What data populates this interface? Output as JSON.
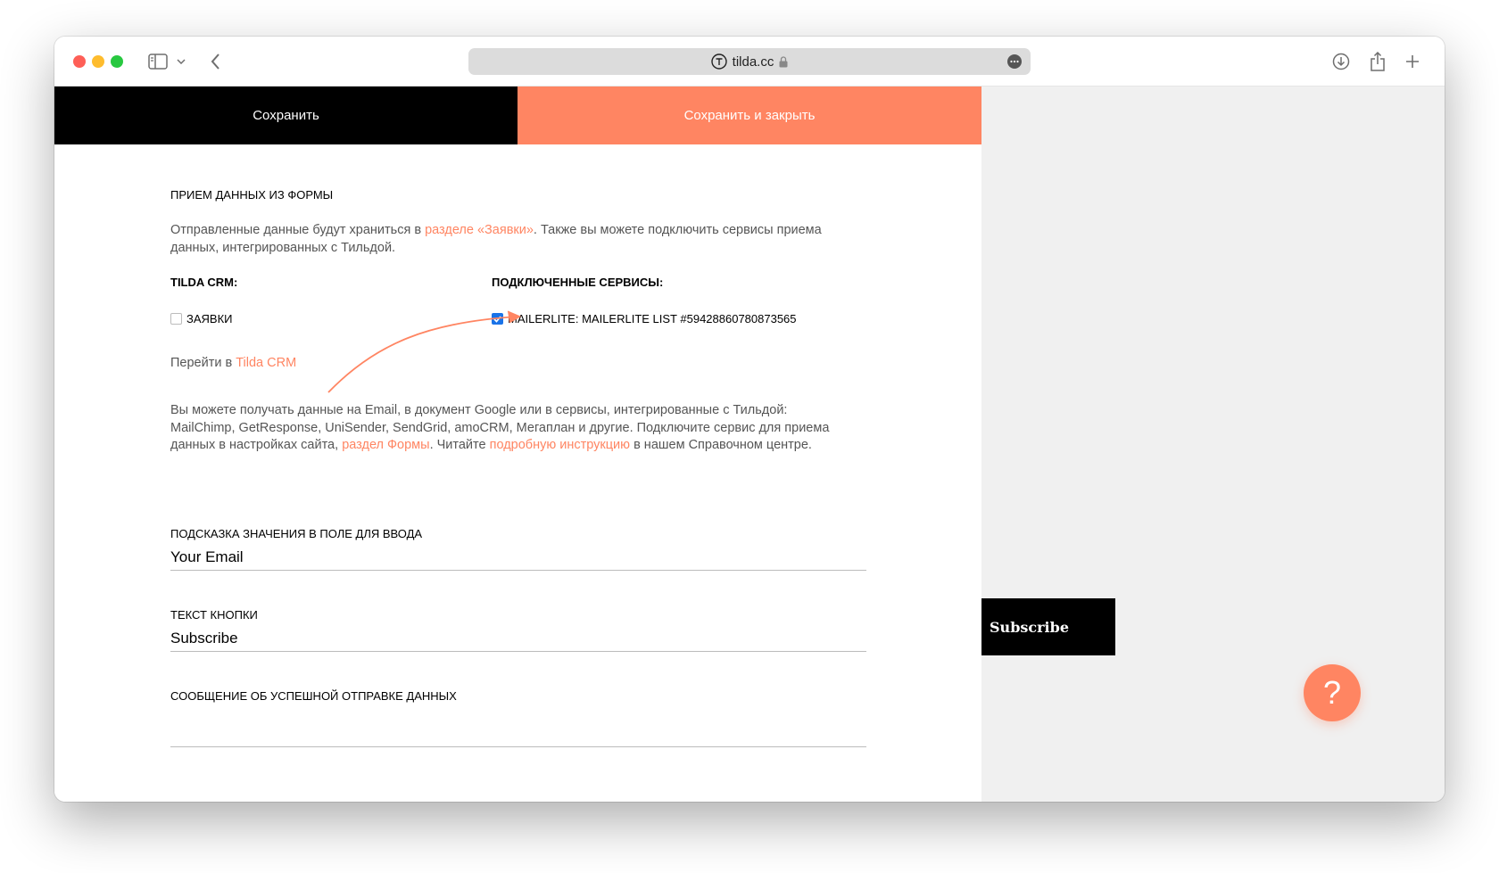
{
  "browser": {
    "url": "tilda.cc"
  },
  "actions": {
    "save_label": "Сохранить",
    "save_close_label": "Сохранить и закрыть"
  },
  "form_data": {
    "title": "ПРИЕМ ДАННЫХ ИЗ ФОРМЫ",
    "intro_before": "Отправленные данные будут храниться в ",
    "intro_link": "разделе «Заявки»",
    "intro_after": ". Также вы можете подключить сервисы приема данных, интегрированных с Тильдой.",
    "crm_heading": "TILDA CRM:",
    "crm_checkbox_label": "ЗАЯВКИ",
    "services_heading": "ПОДКЛЮЧЕННЫЕ СЕРВИСЫ:",
    "service_checkbox_label": "MAILERLITE: MAILERLITE LIST #59428860780873565",
    "goto_prefix": "Перейти в ",
    "goto_link": "Tilda CRM",
    "info_part1": "Вы можете получать данные на Email, в документ Google или в сервисы, интегрированные с Тильдой: MailChimp, GetResponse, UniSender, SendGrid, amoCRM, Мегаплан и другие. Подключите сервис для приема данных в настройках сайта, ",
    "info_link1": "раздел Формы",
    "info_part2": ". Читайте ",
    "info_link2": "подробную инструкцию",
    "info_part3": " в нашем Справочном центре."
  },
  "fields": {
    "placeholder_label": "ПОДСКАЗКА ЗНАЧЕНИЯ В ПОЛЕ ДЛЯ ВВОДА",
    "placeholder_value": "Your Email",
    "button_text_label": "ТЕКСТ КНОПКИ",
    "button_text_value": "Subscribe",
    "success_label": "СООБЩЕНИЕ ОБ УСПЕШНОЙ ОТПРАВКЕ ДАННЫХ",
    "success_value": ""
  },
  "preview": {
    "subscribe_label": "Subscribe"
  },
  "help": {
    "label": "?"
  },
  "colors": {
    "accent": "#ff8562",
    "checkbox": "#1a73e8"
  },
  "icons": {
    "sidebar": "sidebar-icon",
    "chevron": "chevron-down-icon",
    "back": "back-icon",
    "site": "tilda-logo-icon",
    "lock": "lock-icon",
    "more": "more-icon",
    "download": "download-icon",
    "share": "share-icon",
    "new_tab": "plus-icon"
  }
}
